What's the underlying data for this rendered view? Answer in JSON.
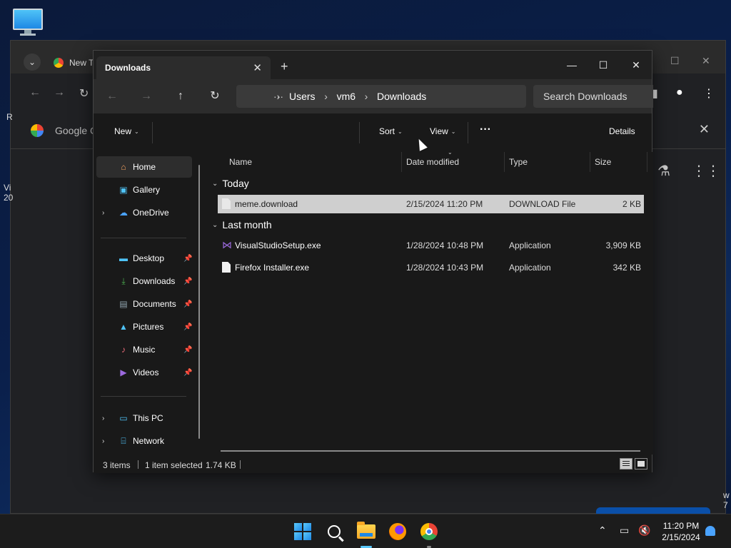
{
  "desktop": {
    "frag_left": [
      "R",
      "Vi",
      "20"
    ],
    "frag_right": [
      "w",
      "7"
    ]
  },
  "chrome": {
    "tab_label": "New T",
    "bookmark_label": "Google C"
  },
  "explorer": {
    "tab_title": "Downloads",
    "breadcrumbs": [
      "Users",
      "vm6",
      "Downloads"
    ],
    "search_placeholder": "Search Downloads",
    "toolbar": {
      "new_label": "New",
      "sort_label": "Sort",
      "view_label": "View",
      "details_label": "Details"
    },
    "sidebar": {
      "home": "Home",
      "gallery": "Gallery",
      "onedrive": "OneDrive",
      "desktop": "Desktop",
      "downloads": "Downloads",
      "documents": "Documents",
      "pictures": "Pictures",
      "music": "Music",
      "videos": "Videos",
      "thispc": "This PC",
      "network": "Network"
    },
    "columns": {
      "name": "Name",
      "date": "Date modified",
      "type": "Type",
      "size": "Size"
    },
    "groups": {
      "today": "Today",
      "last_month": "Last month"
    },
    "files": [
      {
        "name": "meme.download",
        "date": "2/15/2024 11:20 PM",
        "type": "DOWNLOAD File",
        "size": "2 KB",
        "selected": true
      },
      {
        "name": "VisualStudioSetup.exe",
        "date": "1/28/2024 10:48 PM",
        "type": "Application",
        "size": "3,909 KB",
        "selected": false
      },
      {
        "name": "Firefox Installer.exe",
        "date": "1/28/2024 10:43 PM",
        "type": "Application",
        "size": "342 KB",
        "selected": false
      }
    ],
    "status": {
      "items": "3 items",
      "selection": "1 item selected",
      "size": "1.74 KB"
    }
  },
  "taskbar": {
    "time": "11:20 PM",
    "date": "2/15/2024"
  }
}
